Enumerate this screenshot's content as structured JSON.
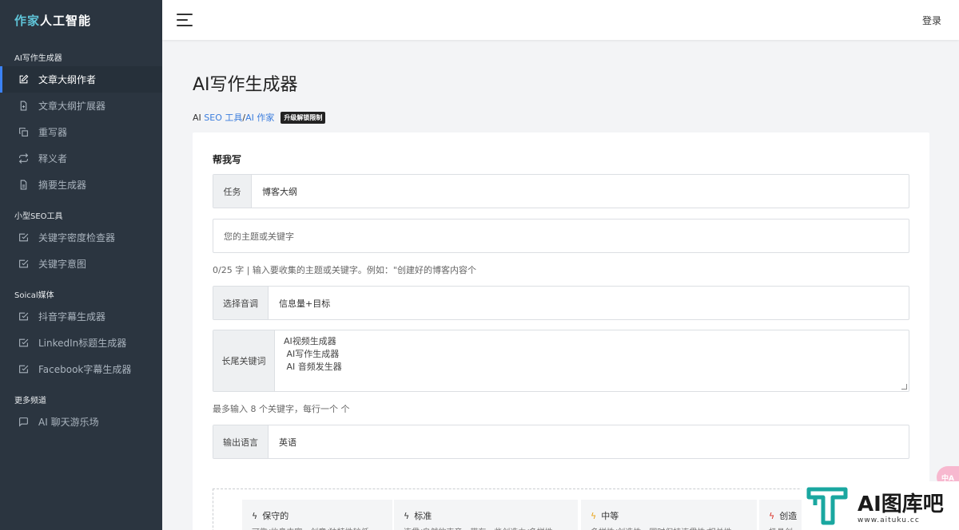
{
  "sidebar": {
    "brand_accent": "作家",
    "brand_rest": "人工智能",
    "sections": [
      {
        "title": "AI写作生成器",
        "items": [
          {
            "label": "文章大纲作者",
            "icon": "edit-icon",
            "active": true
          },
          {
            "label": "文章大纲扩展器",
            "icon": "file-plus-icon"
          },
          {
            "label": "重写器",
            "icon": "copy-icon"
          },
          {
            "label": "释义者",
            "icon": "repeat-icon"
          },
          {
            "label": "摘要生成器",
            "icon": "file-text-icon"
          }
        ]
      },
      {
        "title": "小型SEO工具",
        "items": [
          {
            "label": "关键字密度检查器",
            "icon": "check-square-icon"
          },
          {
            "label": "关键字意图",
            "icon": "check-square-icon"
          }
        ]
      },
      {
        "title": "Soical媒体",
        "items": [
          {
            "label": "抖音字幕生成器",
            "icon": "check-square-icon"
          },
          {
            "label": "LinkedIn标题生成器",
            "icon": "check-square-icon"
          },
          {
            "label": "Facebook字幕生成器",
            "icon": "check-square-icon"
          }
        ]
      },
      {
        "title": "更多频道",
        "items": [
          {
            "label": "AI 聊天游乐场",
            "icon": "message-icon"
          }
        ]
      }
    ]
  },
  "topbar": {
    "login_label": "登录"
  },
  "main": {
    "title": "AI写作生成器",
    "breadcrumb": {
      "prefix": "AI ",
      "link1": "SEO 工具",
      "sep": "/",
      "link2": "AI 作家",
      "badge": "升级解锁限制"
    },
    "card_title": "帮我写",
    "task": {
      "label": "任务",
      "value": "博客大纲"
    },
    "topic": {
      "placeholder": "您的主题或关键字"
    },
    "topic_hint": "0/25 字 | 输入要收集的主题或关键字。例如：\"创建好的博客内容个",
    "tone": {
      "label": "选择音调",
      "value": "信息量+目标"
    },
    "keywords": {
      "label": "长尾关键词",
      "value": "AI视频生成器\n AI写作生成器\n AI 音频发生器"
    },
    "keywords_hint": "最多输入 8 个关键字，每行一个 个",
    "language": {
      "label": "输出语言",
      "value": "英语"
    },
    "tones": [
      {
        "name": "保守的",
        "desc": "可靠/信息丰富，创意/独特性较低",
        "color": "#333333"
      },
      {
        "name": "标准",
        "desc": "连贯/自然的声音，带有一些创造力/多样性",
        "color": "#333333"
      },
      {
        "name": "中等",
        "desc": "多样性/创造性，同时保持连贯性/相关性",
        "color": "#e8a317"
      },
      {
        "name": "创造",
        "desc": "极具创",
        "color": "#d93025"
      }
    ]
  },
  "floater": {
    "text": "中A"
  },
  "watermark": {
    "text": "AI图库吧",
    "url": "www.aituku.cc",
    "color": "#1aa7a0"
  }
}
